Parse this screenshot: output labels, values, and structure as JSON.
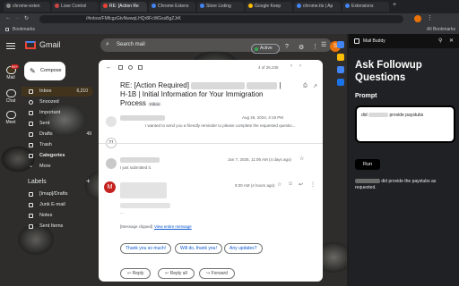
{
  "tabs": [
    {
      "label": "chrome-exten"
    },
    {
      "label": "Lose Control"
    },
    {
      "label": "RE: [Action Re"
    },
    {
      "label": "Chrome Extens"
    },
    {
      "label": "Store Listing"
    },
    {
      "label": "Google Keep"
    },
    {
      "label": "chrome.tts | Ap"
    },
    {
      "label": "Extensions"
    }
  ],
  "address": {
    "url": "/#inbox/FMfcgzGtvNwwqLHQr8FcWGssBgZJrK"
  },
  "bookmarks": {
    "label": "Bookmarks",
    "all": "All Bookmarks"
  },
  "gmail": {
    "logo": "Gmail",
    "search_placeholder": "Search mail",
    "status": "Active",
    "avatar": "S",
    "compose": "Compose",
    "rail": [
      {
        "label": "Mail",
        "badge": "99+"
      },
      {
        "label": "Chat"
      },
      {
        "label": "Meet"
      }
    ],
    "nav": [
      {
        "label": "Inbox",
        "count": "6,210"
      },
      {
        "label": "Snoozed",
        "count": ""
      },
      {
        "label": "Important",
        "count": ""
      },
      {
        "label": "Sent",
        "count": ""
      },
      {
        "label": "Drafts",
        "count": "49"
      },
      {
        "label": "Trash",
        "count": ""
      },
      {
        "label": "Categories",
        "count": ""
      },
      {
        "label": "More",
        "count": ""
      }
    ],
    "labels_heading": "Labels",
    "labels": [
      "[Imap]/Drafts",
      "Junk E-mail",
      "Notes",
      "Sent Items"
    ]
  },
  "email": {
    "pager": "4 of 26,235",
    "subject_start": "RE: [Action Required]",
    "subject_end": "| H-1B | Initial Information for Your Immigration Process",
    "tag": "Inbox",
    "msg1": {
      "date": "Aug 26, 2024, 4:19 PM",
      "snippet": "I wanted to send you a friendly reminder to please complete the requested questio..."
    },
    "collapsed_count": "21",
    "msg2": {
      "date": "Jan 7, 2025, 11:06 AM (4 days ago)",
      "snippet": "I just submitted it."
    },
    "msg3": {
      "avatar": "M",
      "date": "9:30 AM (4 hours ago)",
      "ellipsis": "...",
      "clipped": "[Message clipped]",
      "view_link": "View entire message"
    },
    "smart_replies": [
      "Thank you so much!",
      "Will do, thank you!",
      "Any updates?"
    ],
    "actions": [
      "Reply",
      "Reply all",
      "Forward"
    ]
  },
  "mailbuddy": {
    "header": "Mail Buddy",
    "title": "Ask Followup Questions",
    "prompt_label": "Prompt",
    "prompt_start": "did",
    "prompt_end": "provide paystubs",
    "run": "Run",
    "response_end": "did provide the paystubs as requested."
  },
  "colors": {
    "accent": "#0b57d0",
    "avatar_red": "#c5221f",
    "avatar_orange": "#e8710a"
  }
}
